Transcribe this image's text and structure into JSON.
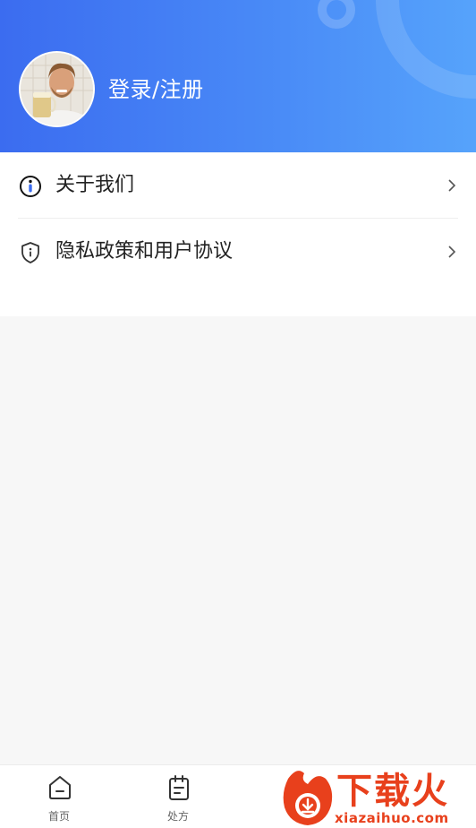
{
  "header": {
    "login_label": "登录/注册"
  },
  "menu": {
    "items": [
      {
        "label": "关于我们",
        "icon": "info-icon"
      },
      {
        "label": "隐私政策和用户协议",
        "icon": "shield-icon"
      }
    ]
  },
  "tabbar": {
    "tabs": [
      {
        "label": "首页",
        "icon": "home-icon"
      },
      {
        "label": "处方",
        "icon": "prescription-icon"
      }
    ]
  },
  "watermark": {
    "title": "下载火",
    "url": "xiazaihuo.com"
  },
  "colors": {
    "header_start": "#3b6cf0",
    "header_end": "#56a3fb",
    "watermark": "#e8401c"
  }
}
